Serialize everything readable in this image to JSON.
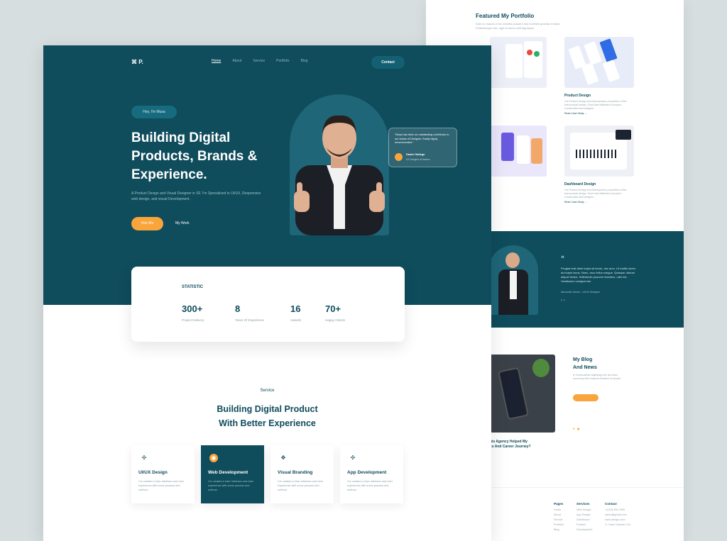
{
  "back": {
    "portfolio": {
      "title": "Featured My Portfolio",
      "subtitle": "Duis eu mauris in leo lobortis posuere nisi molestie gravida et dolor. Pellentesque nisl, eget et lorem velit dignissim.",
      "cards": [
        {
          "title": "",
          "text": "",
          "more": ""
        },
        {
          "title": "Product Design",
          "text": "Our Product Design and development, proposition of the best product design. Good idea fulfillment of project. Consecutive best designer.",
          "more": "Read Case Study →"
        },
        {
          "title": "",
          "text": "",
          "more": ""
        },
        {
          "title": "Dashboard Design",
          "text": "Our Product Design and development, proposition of the best product design. Good idea fulfillment of project. Consecutive best designer.",
          "more": "Read Case Study →"
        }
      ]
    },
    "testimonial": {
      "quote_mark": "❝",
      "text": "Feugiat erat diam turpis sit lorem, nec arcu. Ut mattis lorem dui turpis lacus. Nunc, arcu tellus congue. Quisque, dictum aliquet lectus. Sollicitudin posuere faucibus, odio est. Vestibulum volutpat nisi.",
      "name": "Alexander Deniel – UI/UX Designer",
      "arrows": "‹  ›"
    },
    "blog": {
      "title_line1": "My Blog",
      "title_line2": "And News",
      "subtitle": "In Consectetuer adipiscing elit, sed diam nonummy nibh euismod tincidunt ut laoreet.",
      "dots": "•●",
      "post_title_line1": "his Agency Helped My",
      "post_title_line2": "ss And Career Journey?"
    },
    "footer": {
      "cols": [
        {
          "title": "Pages",
          "items": [
            "Home",
            "About",
            "Service",
            "Portfolio",
            "Blog"
          ]
        },
        {
          "title": "Services",
          "items": [
            "Web Design",
            "App Design",
            "Dashboard",
            "Product",
            "Development"
          ]
        },
        {
          "title": "Contact",
          "items": [
            "+(123) 456-7890",
            "name@gmail.com",
            "www.design.com",
            "Jl. Gatot Subroto 123"
          ]
        }
      ]
    }
  },
  "front": {
    "nav": {
      "logo": "⌘ P.",
      "links": [
        "Home",
        "About",
        "Service",
        "Portfolio",
        "Blog"
      ],
      "active_index": 0,
      "contact_label": "Contact"
    },
    "hero": {
      "greeting": "Hey, I'm Musa",
      "headline": "Building Digital Products, Brands & Experience.",
      "intro": "A Product Design and Visual Designer in SF. I'm Specialized in UI/UX, Responsive web design, and visual Development.",
      "hire_label": "Hire Me",
      "work_label": "My Work",
      "review_text": "\"Musa has been an outstanding contributor to our teams of Designer. Easily highly recommended.\"",
      "review_name": "Daniel Gallego",
      "review_role": "UX Designer at Heaven"
    },
    "statistic": {
      "label": "STATISTIC",
      "items": [
        {
          "value": "300+",
          "caption": "Project Delivery"
        },
        {
          "value": "8",
          "caption": "Years Of Experience"
        },
        {
          "value": "16",
          "caption": "Awards"
        },
        {
          "value": "70+",
          "caption": "Happy Clients"
        }
      ]
    },
    "services": {
      "kicker": "Service",
      "title_line1": "Building Digital Product",
      "title_line2": "With Better Experience",
      "items": [
        {
          "title": "UI/UX Design",
          "text": "I've created a User Interface and User experience with some process and method.",
          "icon": "✣"
        },
        {
          "title": "Web Development",
          "text": "I've created a User Interface and User experience with some process and method.",
          "icon": "◉"
        },
        {
          "title": "Visual Branding",
          "text": "I've created a User Interface and User experience with some process and method.",
          "icon": "✥"
        },
        {
          "title": "App Development",
          "text": "I've created a User Interface and User experience with some process and method.",
          "icon": "✣"
        }
      ]
    }
  },
  "colors": {
    "teal": "#0f4c5c",
    "orange": "#f9a53c",
    "backdrop": "#d6dee0"
  }
}
